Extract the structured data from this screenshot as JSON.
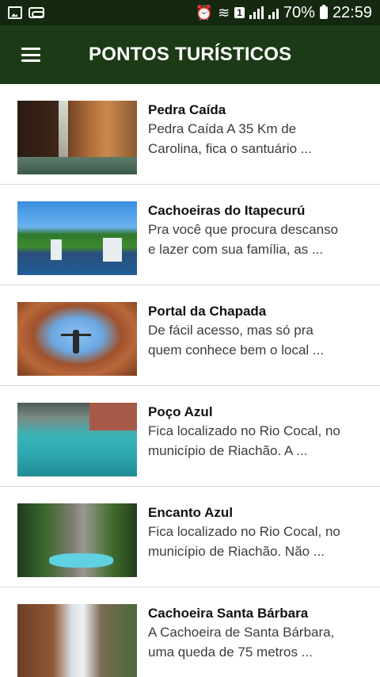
{
  "status_bar": {
    "battery_percent": "70%",
    "time": "22:59",
    "sim_label": "1"
  },
  "app_bar": {
    "title": "PONTOS TURÍSTICOS"
  },
  "items": [
    {
      "title": "Pedra Caída",
      "desc_line1": "Pedra Caída A 35 Km de",
      "desc_line2": "Carolina, fica o santuário ..."
    },
    {
      "title": "Cachoeiras do Itapecurú",
      "desc_line1": "Pra você que procura descanso",
      "desc_line2": "e lazer com sua família, as ..."
    },
    {
      "title": "Portal da Chapada",
      "desc_line1": "De fácil acesso, mas só pra",
      "desc_line2": "quem conhece bem o local ..."
    },
    {
      "title": "Poço Azul",
      "desc_line1": "Fica localizado no Rio Cocal, no",
      "desc_line2": "município de Riachão. A ..."
    },
    {
      "title": "Encanto Azul",
      "desc_line1": "Fica localizado no Rio Cocal, no",
      "desc_line2": "município de Riachão. Não ..."
    },
    {
      "title": "Cachoeira Santa Bárbara",
      "desc_line1": "A Cachoeira de Santa Bárbara,",
      "desc_line2": "uma queda de 75 metros ..."
    }
  ],
  "colors": {
    "status_bar": "#152810",
    "app_bar": "#1d3a16"
  }
}
